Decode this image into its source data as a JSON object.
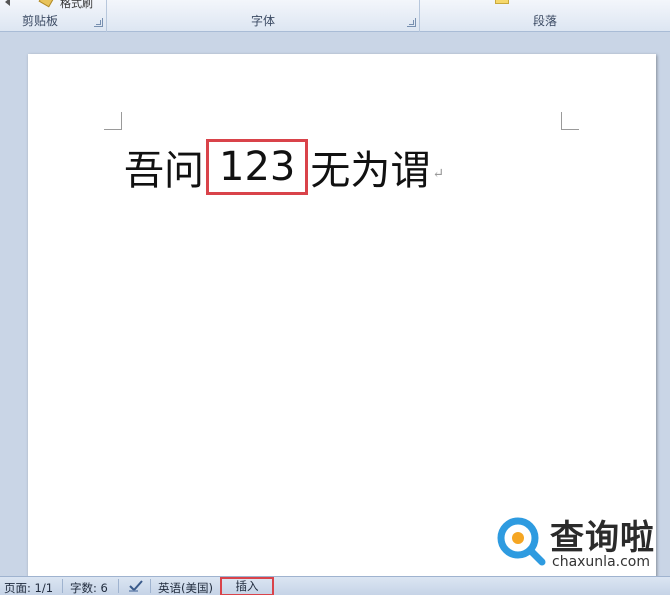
{
  "ribbon": {
    "groups": [
      {
        "label": "剪贴板"
      },
      {
        "label": "字体"
      },
      {
        "label": "段落"
      }
    ],
    "format_painter_label": "格式刷"
  },
  "document": {
    "text_before": "吾问",
    "highlight_text": "123",
    "text_after": "无为谓",
    "paragraph_mark": "↵"
  },
  "statusbar": {
    "page": "页面: 1/1",
    "word_count": "字数: 6",
    "language": "英语(美国)",
    "mode": "插入"
  },
  "watermark": {
    "brand": "查询啦",
    "domain": "chaxunla.com"
  },
  "colors": {
    "highlight": "#d9434a",
    "ribbon_bg": "#dde6f2",
    "page_bg": "#ffffff"
  }
}
